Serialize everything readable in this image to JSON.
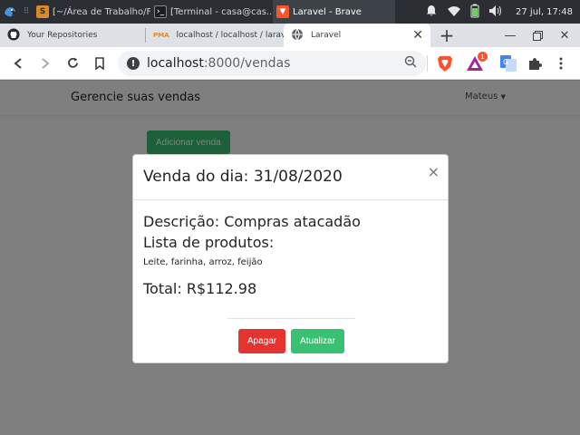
{
  "taskbar": {
    "tasks": [
      {
        "label": "[~/Área de Trabalho/F..."
      },
      {
        "label": "[Terminal - casa@cas..."
      },
      {
        "label": "Laravel - Brave"
      }
    ],
    "clock": "27 jul, 17:48"
  },
  "browser": {
    "tabs": [
      {
        "label": "Your Repositories"
      },
      {
        "label": "localhost / localhost / larav"
      },
      {
        "label": "Laravel"
      }
    ],
    "new_tab": "+",
    "url_host": "localhost",
    "url_rest": ":8000/vendas",
    "brave_badge": "1"
  },
  "app": {
    "brand": "Gerencie suas vendas",
    "user": "Mateus",
    "add_button": "Adicionar venda"
  },
  "modal": {
    "title": "Venda do dia: 31/08/2020",
    "close": "×",
    "description": "Descrição: Compras atacadão",
    "products_title": "Lista de produtos:",
    "products": "Leite, farinha, arroz, feijão",
    "total": "Total: R$112.98",
    "delete_button": "Apagar",
    "update_button": "Atualizar"
  },
  "colors": {
    "success": "#38c172",
    "danger": "#e3342f",
    "taskbar": "#2b2f33"
  }
}
